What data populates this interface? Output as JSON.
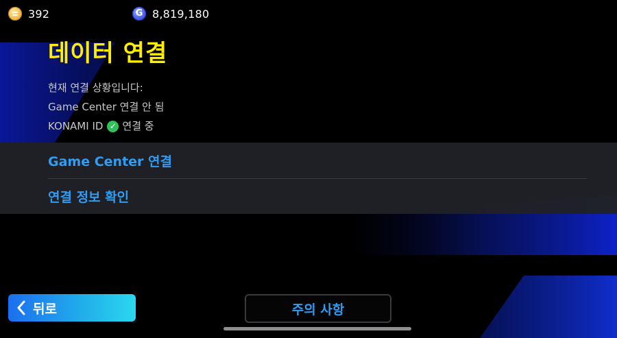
{
  "currency": {
    "coins": "392",
    "gp": "8,819,180",
    "gp_icon_letter": "G"
  },
  "page": {
    "title": "데이터 연결"
  },
  "status": {
    "intro": "현재 연결 상황입니다:",
    "game_center": "Game Center 연결 안 됨",
    "konami_id_label": "KONAMI ID",
    "konami_id_state": "연결 중",
    "check_glyph": "✓"
  },
  "menu": {
    "items": [
      {
        "label": "Game Center 연결"
      },
      {
        "label": "연결 정보 확인"
      }
    ]
  },
  "buttons": {
    "back_label": "뒤로",
    "notice_label": "주의 사항"
  },
  "colors": {
    "title": "#ffee00",
    "menu_text": "#2f9df4",
    "accent_blue": "#1c6ff0",
    "check_green": "#2fc25a"
  },
  "icons": {
    "coin": "coin-icon",
    "gp": "gp-icon",
    "check": "check-icon",
    "back": "chevron-left-icon"
  }
}
